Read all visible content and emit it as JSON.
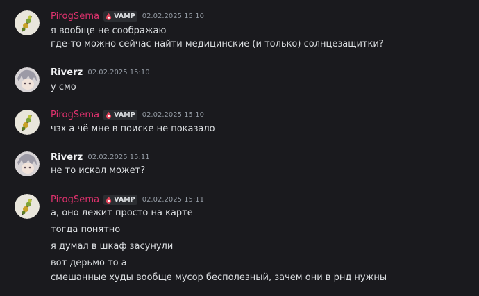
{
  "messages": [
    {
      "author": "PirogSema",
      "tag": "VAMP",
      "timestamp": "02.02.2025 15:10",
      "lines": [
        "я вообще не соображаю",
        "где-то можно сейчас найти медицинские (и только) солнцезащитки?"
      ]
    },
    {
      "author": "Riverz",
      "timestamp": "02.02.2025 15:10",
      "lines": [
        "у смо"
      ]
    },
    {
      "author": "PirogSema",
      "tag": "VAMP",
      "timestamp": "02.02.2025 15:10",
      "lines": [
        "чзх а чё мне в поиске не показало"
      ]
    },
    {
      "author": "Riverz",
      "timestamp": "02.02.2025 15:11",
      "lines": [
        "не то искал может?"
      ]
    },
    {
      "author": "PirogSema",
      "tag": "VAMP",
      "timestamp": "02.02.2025 15:11",
      "lines": [
        "а, оно лежит просто на карте",
        "тогда понятно",
        "я думал в шкаф засунули",
        "вот дерьмо то а",
        "смешанные худы вообще мусор бесполезный, зачем они в рнд нужны"
      ]
    }
  ],
  "colors": {
    "background": "#1a1a1e",
    "pirog_name": "#e0326e",
    "riverz_name": "#f2f3f5",
    "message_text": "#dbdee1",
    "timestamp": "#949ba4",
    "tag_icon": "#e0445a"
  },
  "icons": {
    "tag": "vamp-drop-icon"
  }
}
